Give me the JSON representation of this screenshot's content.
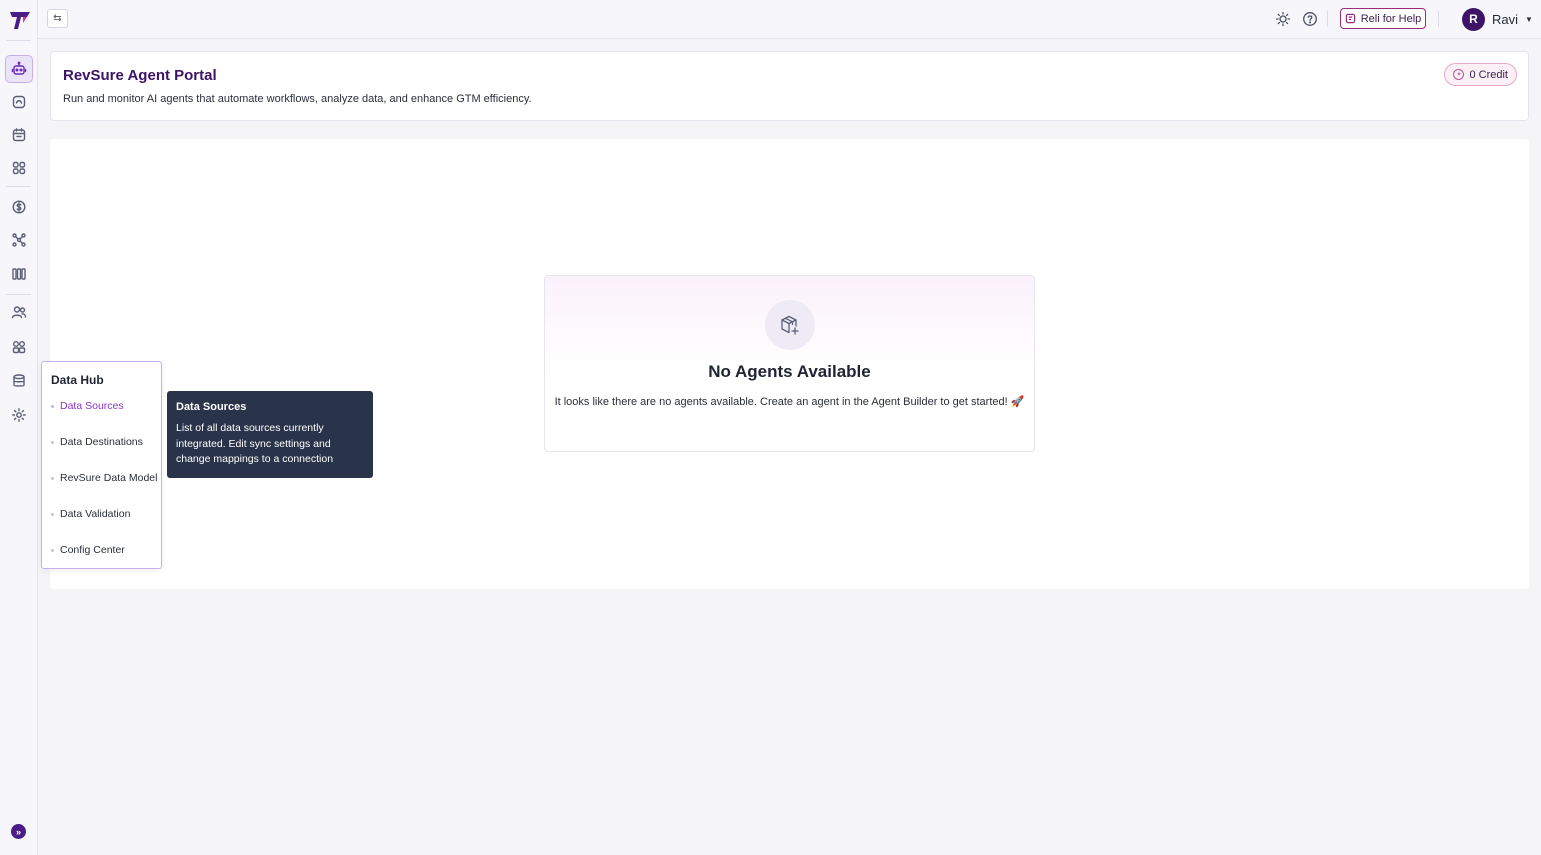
{
  "topbar": {
    "help_label": "Reli for Help",
    "user_initial": "R",
    "user_name": "Ravi"
  },
  "header": {
    "title": "RevSure Agent Portal",
    "subtitle": "Run and monitor AI agents that automate workflows, analyze data, and enhance GTM efficiency.",
    "credit": "0 Credit"
  },
  "empty_state": {
    "title": "No Agents Available",
    "description": "It looks like there are no agents available. Create an agent in the Agent Builder to get started! 🚀"
  },
  "sidebar": {
    "icons": [
      "agent-icon",
      "insights-icon",
      "calendar-icon",
      "apps-grid-icon",
      "dollar-icon",
      "funnel-icon",
      "columns-icon",
      "users-icon",
      "accounts-icon",
      "database-icon",
      "settings-icon"
    ],
    "active": "agent-icon"
  },
  "flyout": {
    "title": "Data Hub",
    "items": [
      {
        "label": "Data Sources"
      },
      {
        "label": "Data Destinations"
      },
      {
        "label": "RevSure Data Model"
      },
      {
        "label": "Data Validation"
      },
      {
        "label": "Config Center"
      }
    ],
    "active_index": 0
  },
  "tooltip": {
    "title": "Data Sources",
    "body": "List of all data sources currently integrated. Edit sync settings and change mappings to a connection"
  },
  "colors": {
    "brand": "#3d1466",
    "accent": "#8a35c4",
    "tooltip_bg": "#29344a"
  }
}
